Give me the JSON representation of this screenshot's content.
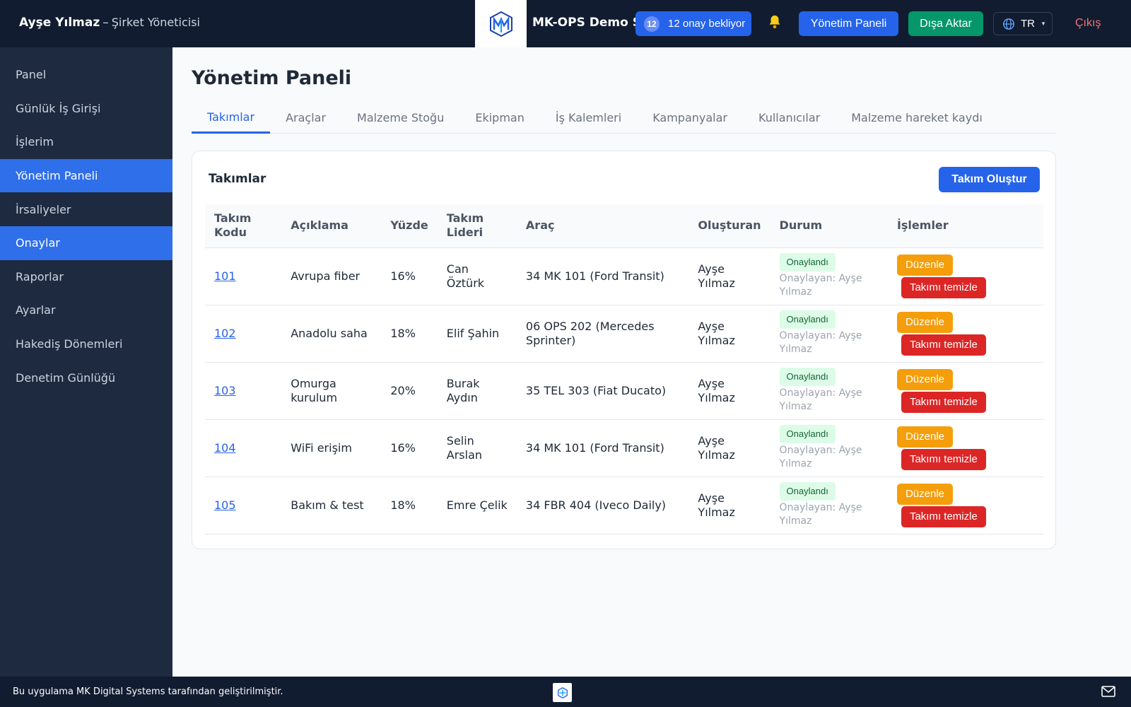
{
  "header": {
    "user_name": "Ayşe Yılmaz",
    "separator": "–",
    "user_role": "Şirket Yöneticisi",
    "company": "MK-OPS Demo Şirketi",
    "approval_count": "12",
    "approval_text": "12 onay bekliyor",
    "admin_button": "Yönetim Paneli",
    "export_button": "Dışa Aktar",
    "language": "TR",
    "logout": "Çıkış"
  },
  "sidebar": {
    "items": [
      {
        "label": "Panel"
      },
      {
        "label": "Günlük İş Girişi"
      },
      {
        "label": "İşlerim"
      },
      {
        "label": "Yönetim Paneli"
      },
      {
        "label": "İrsaliyeler"
      },
      {
        "label": "Onaylar"
      },
      {
        "label": "Raporlar"
      },
      {
        "label": "Ayarlar"
      },
      {
        "label": "Hakediş Dönemleri"
      },
      {
        "label": "Denetim Günlüğü"
      }
    ]
  },
  "main": {
    "title": "Yönetim Paneli",
    "tabs": [
      {
        "label": "Takımlar"
      },
      {
        "label": "Araçlar"
      },
      {
        "label": "Malzeme Stoğu"
      },
      {
        "label": "Ekipman"
      },
      {
        "label": "İş Kalemleri"
      },
      {
        "label": "Kampanyalar"
      },
      {
        "label": "Kullanıcılar"
      },
      {
        "label": "Malzeme hareket kaydı"
      }
    ],
    "card_title": "Takımlar",
    "create_button": "Takım Oluştur",
    "columns": [
      "Takım Kodu",
      "Açıklama",
      "Yüzde",
      "Takım Lideri",
      "Araç",
      "Oluşturan",
      "Durum",
      "İşlemler"
    ],
    "rows": [
      {
        "code": "101",
        "description": "Avrupa fiber",
        "percent": "16%",
        "leader": "Can Öztürk",
        "vehicle": "34 MK 101 (Ford Transit)",
        "creator": "Ayşe Yılmaz",
        "status": "Onaylandı",
        "approved_by": "Onaylayan: Ayşe Yılmaz",
        "edit": "Düzenle",
        "clear": "Takımı temizle"
      },
      {
        "code": "102",
        "description": "Anadolu saha",
        "percent": "18%",
        "leader": "Elif Şahin",
        "vehicle": "06 OPS 202 (Mercedes Sprinter)",
        "creator": "Ayşe Yılmaz",
        "status": "Onaylandı",
        "approved_by": "Onaylayan: Ayşe Yılmaz",
        "edit": "Düzenle",
        "clear": "Takımı temizle"
      },
      {
        "code": "103",
        "description": "Omurga kurulum",
        "percent": "20%",
        "leader": "Burak Aydın",
        "vehicle": "35 TEL 303 (Fiat Ducato)",
        "creator": "Ayşe Yılmaz",
        "status": "Onaylandı",
        "approved_by": "Onaylayan: Ayşe Yılmaz",
        "edit": "Düzenle",
        "clear": "Takımı temizle"
      },
      {
        "code": "104",
        "description": "WiFi erişim",
        "percent": "16%",
        "leader": "Selin Arslan",
        "vehicle": "34 MK 101 (Ford Transit)",
        "creator": "Ayşe Yılmaz",
        "status": "Onaylandı",
        "approved_by": "Onaylayan: Ayşe Yılmaz",
        "edit": "Düzenle",
        "clear": "Takımı temizle"
      },
      {
        "code": "105",
        "description": "Bakım & test",
        "percent": "18%",
        "leader": "Emre Çelik",
        "vehicle": "34 FBR 404 (Iveco Daily)",
        "creator": "Ayşe Yılmaz",
        "status": "Onaylandı",
        "approved_by": "Onaylayan: Ayşe Yılmaz",
        "edit": "Düzenle",
        "clear": "Takımı temizle"
      }
    ]
  },
  "footer": {
    "text": "Bu uygulama MK Digital Systems tarafından geliştirilmiştir."
  },
  "icons": {
    "logo": "mk-logo-icon",
    "bell": "bell-icon",
    "globe": "globe-icon",
    "mail": "mail-icon"
  },
  "colors": {
    "header_bg": "#111c30",
    "sidebar_bg": "#1d2a40",
    "accent": "#2563eb",
    "active_sidebar": "#2f6fe9",
    "export": "#059669",
    "edit": "#f59e0b",
    "danger": "#dc2626",
    "badge_bg": "#dcfce7"
  }
}
